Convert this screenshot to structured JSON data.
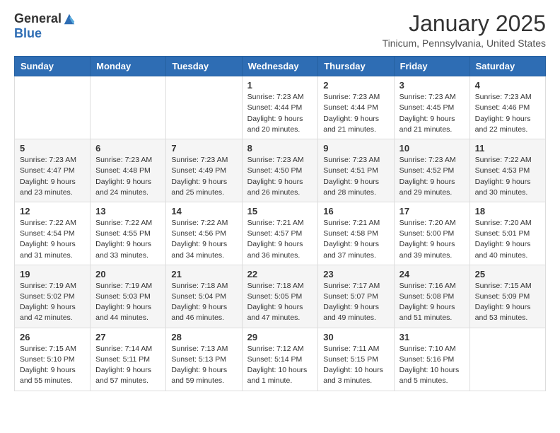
{
  "logo": {
    "general": "General",
    "blue": "Blue"
  },
  "title": "January 2025",
  "subtitle": "Tinicum, Pennsylvania, United States",
  "weekdays": [
    "Sunday",
    "Monday",
    "Tuesday",
    "Wednesday",
    "Thursday",
    "Friday",
    "Saturday"
  ],
  "weeks": [
    [
      null,
      null,
      null,
      {
        "day": "1",
        "sunrise": "7:23 AM",
        "sunset": "4:44 PM",
        "daylight": "9 hours and 20 minutes."
      },
      {
        "day": "2",
        "sunrise": "7:23 AM",
        "sunset": "4:44 PM",
        "daylight": "9 hours and 21 minutes."
      },
      {
        "day": "3",
        "sunrise": "7:23 AM",
        "sunset": "4:45 PM",
        "daylight": "9 hours and 21 minutes."
      },
      {
        "day": "4",
        "sunrise": "7:23 AM",
        "sunset": "4:46 PM",
        "daylight": "9 hours and 22 minutes."
      }
    ],
    [
      {
        "day": "5",
        "sunrise": "7:23 AM",
        "sunset": "4:47 PM",
        "daylight": "9 hours and 23 minutes."
      },
      {
        "day": "6",
        "sunrise": "7:23 AM",
        "sunset": "4:48 PM",
        "daylight": "9 hours and 24 minutes."
      },
      {
        "day": "7",
        "sunrise": "7:23 AM",
        "sunset": "4:49 PM",
        "daylight": "9 hours and 25 minutes."
      },
      {
        "day": "8",
        "sunrise": "7:23 AM",
        "sunset": "4:50 PM",
        "daylight": "9 hours and 26 minutes."
      },
      {
        "day": "9",
        "sunrise": "7:23 AM",
        "sunset": "4:51 PM",
        "daylight": "9 hours and 28 minutes."
      },
      {
        "day": "10",
        "sunrise": "7:23 AM",
        "sunset": "4:52 PM",
        "daylight": "9 hours and 29 minutes."
      },
      {
        "day": "11",
        "sunrise": "7:22 AM",
        "sunset": "4:53 PM",
        "daylight": "9 hours and 30 minutes."
      }
    ],
    [
      {
        "day": "12",
        "sunrise": "7:22 AM",
        "sunset": "4:54 PM",
        "daylight": "9 hours and 31 minutes."
      },
      {
        "day": "13",
        "sunrise": "7:22 AM",
        "sunset": "4:55 PM",
        "daylight": "9 hours and 33 minutes."
      },
      {
        "day": "14",
        "sunrise": "7:22 AM",
        "sunset": "4:56 PM",
        "daylight": "9 hours and 34 minutes."
      },
      {
        "day": "15",
        "sunrise": "7:21 AM",
        "sunset": "4:57 PM",
        "daylight": "9 hours and 36 minutes."
      },
      {
        "day": "16",
        "sunrise": "7:21 AM",
        "sunset": "4:58 PM",
        "daylight": "9 hours and 37 minutes."
      },
      {
        "day": "17",
        "sunrise": "7:20 AM",
        "sunset": "5:00 PM",
        "daylight": "9 hours and 39 minutes."
      },
      {
        "day": "18",
        "sunrise": "7:20 AM",
        "sunset": "5:01 PM",
        "daylight": "9 hours and 40 minutes."
      }
    ],
    [
      {
        "day": "19",
        "sunrise": "7:19 AM",
        "sunset": "5:02 PM",
        "daylight": "9 hours and 42 minutes."
      },
      {
        "day": "20",
        "sunrise": "7:19 AM",
        "sunset": "5:03 PM",
        "daylight": "9 hours and 44 minutes."
      },
      {
        "day": "21",
        "sunrise": "7:18 AM",
        "sunset": "5:04 PM",
        "daylight": "9 hours and 46 minutes."
      },
      {
        "day": "22",
        "sunrise": "7:18 AM",
        "sunset": "5:05 PM",
        "daylight": "9 hours and 47 minutes."
      },
      {
        "day": "23",
        "sunrise": "7:17 AM",
        "sunset": "5:07 PM",
        "daylight": "9 hours and 49 minutes."
      },
      {
        "day": "24",
        "sunrise": "7:16 AM",
        "sunset": "5:08 PM",
        "daylight": "9 hours and 51 minutes."
      },
      {
        "day": "25",
        "sunrise": "7:15 AM",
        "sunset": "5:09 PM",
        "daylight": "9 hours and 53 minutes."
      }
    ],
    [
      {
        "day": "26",
        "sunrise": "7:15 AM",
        "sunset": "5:10 PM",
        "daylight": "9 hours and 55 minutes."
      },
      {
        "day": "27",
        "sunrise": "7:14 AM",
        "sunset": "5:11 PM",
        "daylight": "9 hours and 57 minutes."
      },
      {
        "day": "28",
        "sunrise": "7:13 AM",
        "sunset": "5:13 PM",
        "daylight": "9 hours and 59 minutes."
      },
      {
        "day": "29",
        "sunrise": "7:12 AM",
        "sunset": "5:14 PM",
        "daylight": "10 hours and 1 minute."
      },
      {
        "day": "30",
        "sunrise": "7:11 AM",
        "sunset": "5:15 PM",
        "daylight": "10 hours and 3 minutes."
      },
      {
        "day": "31",
        "sunrise": "7:10 AM",
        "sunset": "5:16 PM",
        "daylight": "10 hours and 5 minutes."
      },
      null
    ]
  ],
  "labels": {
    "sunrise": "Sunrise:",
    "sunset": "Sunset:",
    "daylight": "Daylight:"
  }
}
